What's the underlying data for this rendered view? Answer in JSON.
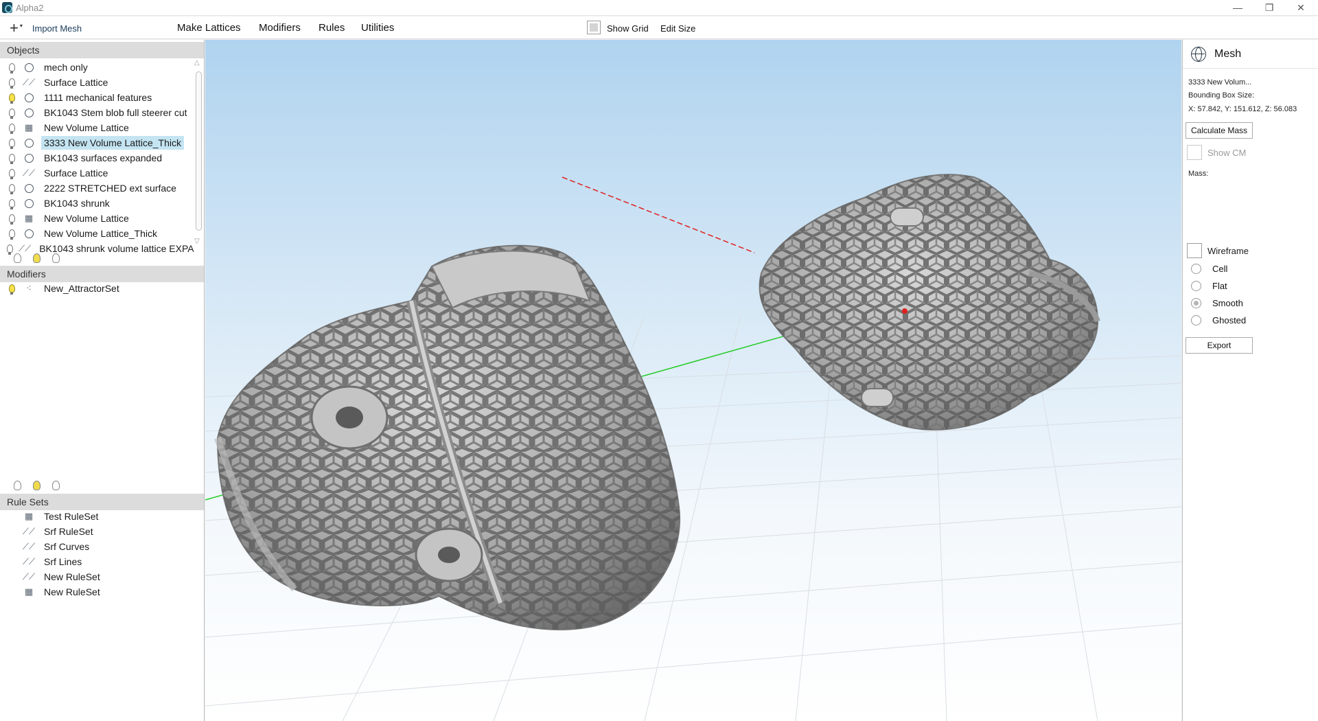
{
  "window": {
    "title": "Alpha2",
    "controls": {
      "minimize": "—",
      "maximize": "❐",
      "close": "✕"
    }
  },
  "menubar": {
    "import_label": "Import Mesh",
    "plus_glyph": "+",
    "caret_glyph": "▾",
    "menus": [
      "Make Lattices",
      "Modifiers",
      "Rules",
      "Utilities"
    ],
    "show_grid_label": "Show Grid",
    "edit_size_label": "Edit Size"
  },
  "objects": {
    "header": "Objects",
    "items": [
      {
        "label": "mech only",
        "type": "mesh",
        "visible": false
      },
      {
        "label": "Surface Lattice",
        "type": "surface",
        "visible": false
      },
      {
        "label": "1111 mechanical features",
        "type": "mesh",
        "visible": true
      },
      {
        "label": "BK1043 Stem blob full steerer cut",
        "type": "mesh",
        "visible": false
      },
      {
        "label": "New Volume Lattice",
        "type": "volume",
        "visible": false
      },
      {
        "label": "3333 New Volume Lattice_Thick",
        "type": "mesh",
        "visible": false,
        "selected": true
      },
      {
        "label": "BK1043 surfaces expanded",
        "type": "mesh",
        "visible": false
      },
      {
        "label": "Surface Lattice",
        "type": "surface",
        "visible": false
      },
      {
        "label": "2222 STRETCHED ext surface",
        "type": "mesh",
        "visible": false
      },
      {
        "label": "BK1043 shrunk",
        "type": "mesh",
        "visible": false
      },
      {
        "label": "New Volume Lattice",
        "type": "volume",
        "visible": false
      },
      {
        "label": "New Volume Lattice_Thick",
        "type": "mesh",
        "visible": false
      },
      {
        "label": "BK1043 shrunk volume lattice EXPANDED",
        "type": "surface",
        "visible": false
      }
    ]
  },
  "modifiers": {
    "header": "Modifiers",
    "items": [
      {
        "label": "New_AttractorSet",
        "type": "attractor",
        "visible": true
      }
    ]
  },
  "rulesets": {
    "header": "Rule Sets",
    "items": [
      {
        "label": "Test RuleSet",
        "type": "volume"
      },
      {
        "label": "Srf RuleSet",
        "type": "surface"
      },
      {
        "label": "Srf Curves",
        "type": "surface"
      },
      {
        "label": "Srf Lines",
        "type": "surface"
      },
      {
        "label": "New RuleSet",
        "type": "surface"
      },
      {
        "label": "New RuleSet",
        "type": "volume"
      }
    ]
  },
  "properties": {
    "title": "Mesh",
    "icon": "globe-icon",
    "name": "3333 New Volum...",
    "bbox_label": "Bounding Box Size:",
    "bbox_value": "X: 57.842, Y: 151.612, Z: 56.083",
    "calc_mass_label": "Calculate Mass",
    "show_cm_label": "Show CM",
    "mass_label": "Mass:",
    "wireframe_label": "Wireframe",
    "render_modes": [
      "Cell",
      "Flat",
      "Smooth",
      "Ghosted"
    ],
    "render_mode_selected": "Smooth",
    "export_label": "Export"
  },
  "colors": {
    "selection": "#c4e4f2",
    "axis_x": "#e02020",
    "axis_y": "#22cc22",
    "mesh": "#9a9a9a",
    "bulb_on": "#f4e24a"
  }
}
